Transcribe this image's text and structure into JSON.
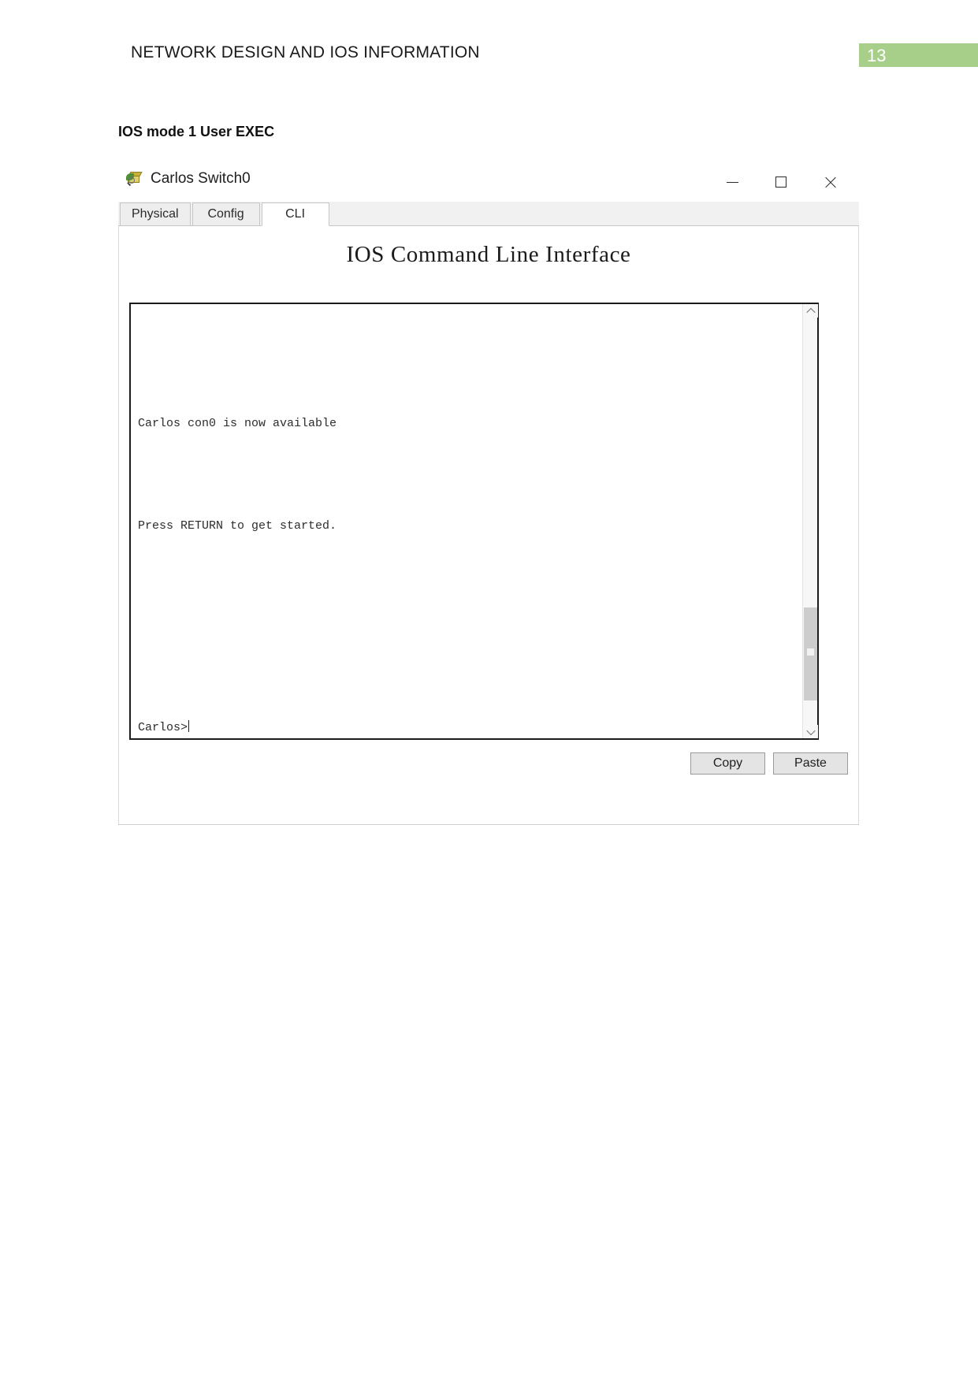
{
  "document": {
    "header_title": "NETWORK DESIGN AND IOS INFORMATION",
    "page_number": "13",
    "page_number_band_color": "#a8cf8a",
    "section_heading": "IOS mode 1 User EXEC"
  },
  "window": {
    "title": "Carlos Switch0",
    "icon": "packet-tracer-device-icon",
    "controls": {
      "minimize": "—",
      "maximize": "□",
      "close": "✕"
    },
    "tabs": [
      {
        "label": "Physical",
        "active": false
      },
      {
        "label": "Config",
        "active": false
      },
      {
        "label": "CLI",
        "active": true
      }
    ]
  },
  "cli": {
    "heading": "IOS Command Line Interface",
    "lines": {
      "available": "Carlos con0 is now available",
      "press_return": "Press RETURN to get started.",
      "prompt": "Carlos>"
    },
    "scrollbar": {
      "up_arrow": "scroll-up-chevron",
      "down_arrow": "scroll-down-chevron"
    },
    "buttons": {
      "copy": "Copy",
      "paste": "Paste"
    }
  }
}
